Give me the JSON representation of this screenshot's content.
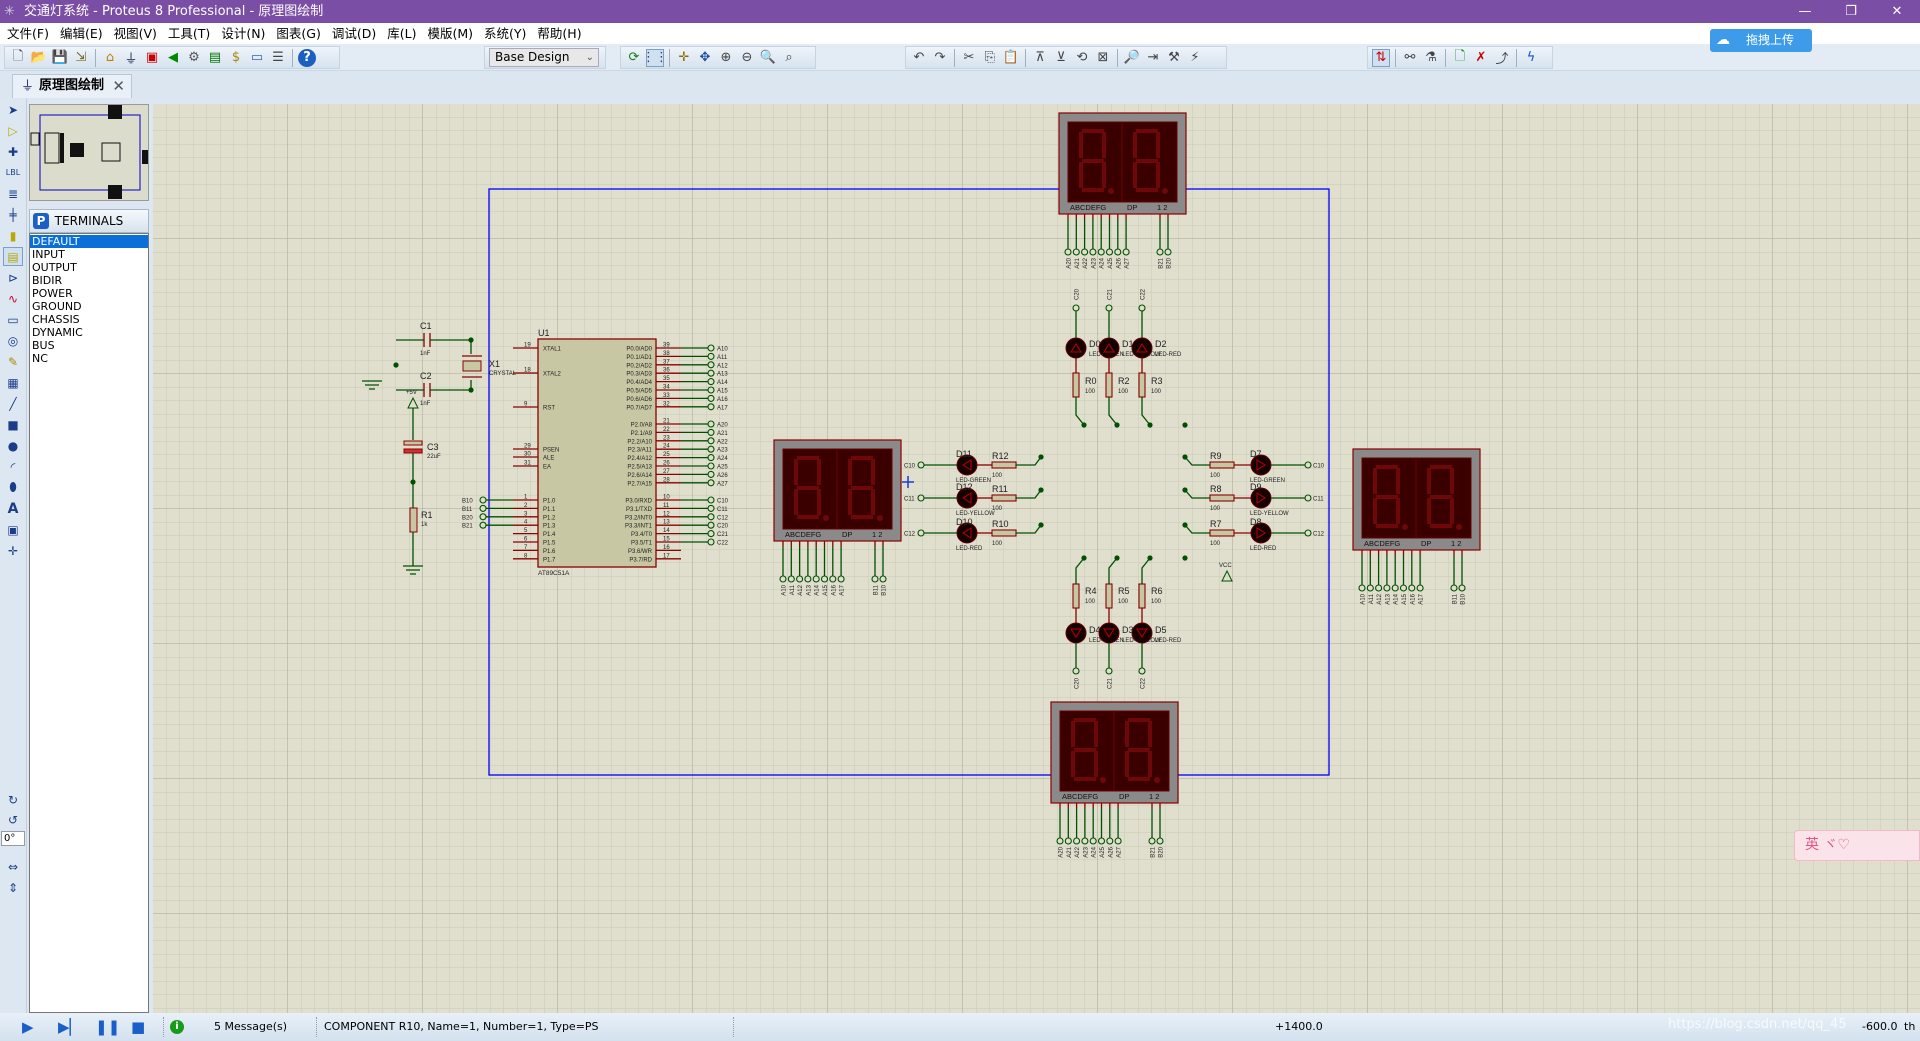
{
  "window": {
    "title": "交通灯系统 - Proteus 8 Professional - 原理图绘制",
    "min": "—",
    "restore": "❐",
    "close": "✕"
  },
  "menu": [
    "文件(F)",
    "编辑(E)",
    "视图(V)",
    "工具(T)",
    "设计(N)",
    "图表(G)",
    "调试(D)",
    "库(L)",
    "模版(M)",
    "系统(Y)",
    "帮助(H)"
  ],
  "toolbar": {
    "design_select": "Base Design",
    "help_icon": "?"
  },
  "upload_button": "拖拽上传",
  "tab": {
    "label": "原理图绘制",
    "close": "✕"
  },
  "panel": {
    "badge": "P",
    "header": "TERMINALS",
    "items": [
      "DEFAULT",
      "INPUT",
      "OUTPUT",
      "BIDIR",
      "POWER",
      "GROUND",
      "CHASSIS",
      "DYNAMIC",
      "BUS",
      "NC"
    ],
    "selected": "DEFAULT"
  },
  "rotation": "0°",
  "status": {
    "messages": "5 Message(s)",
    "info": "COMPONENT R10, Name=1, Number=1, Type=PS",
    "x": "+1400.0",
    "y": "-600.0",
    "unit": "th"
  },
  "ime_widget": "英 ヾ♡",
  "watermark": "https://blog.csdn.net/qq_45",
  "colors": {
    "titlebar": "#7a4ea4",
    "wire": "#005000",
    "pin": "#8b0000",
    "sheet_border": "#0000ff",
    "grid_bg": "#e0dfce",
    "selection": "#0a6fd8"
  },
  "schematic": {
    "u1": {
      "ref": "U1",
      "part": "AT89C51A",
      "left_pins": [
        {
          "num": "19",
          "name": "XTAL1"
        },
        {
          "num": "18",
          "name": "XTAL2"
        },
        {
          "num": "9",
          "name": "RST"
        },
        {
          "num": "29",
          "name": "PSEN"
        },
        {
          "num": "30",
          "name": "ALE"
        },
        {
          "num": "31",
          "name": "EA"
        },
        {
          "num": "1",
          "name": "P1.0",
          "net": "B10"
        },
        {
          "num": "2",
          "name": "P1.1",
          "net": "B11"
        },
        {
          "num": "3",
          "name": "P1.2",
          "net": "B20"
        },
        {
          "num": "4",
          "name": "P1.3",
          "net": "B21"
        },
        {
          "num": "5",
          "name": "P1.4"
        },
        {
          "num": "6",
          "name": "P1.5"
        },
        {
          "num": "7",
          "name": "P1.6"
        },
        {
          "num": "8",
          "name": "P1.7"
        }
      ],
      "right_pins": [
        {
          "num": "39",
          "name": "P0.0/AD0",
          "net": "A10"
        },
        {
          "num": "38",
          "name": "P0.1/AD1",
          "net": "A11"
        },
        {
          "num": "37",
          "name": "P0.2/AD2",
          "net": "A12"
        },
        {
          "num": "36",
          "name": "P0.3/AD3",
          "net": "A13"
        },
        {
          "num": "35",
          "name": "P0.4/AD4",
          "net": "A14"
        },
        {
          "num": "34",
          "name": "P0.5/AD5",
          "net": "A15"
        },
        {
          "num": "33",
          "name": "P0.6/AD6",
          "net": "A16"
        },
        {
          "num": "32",
          "name": "P0.7/AD7",
          "net": "A17"
        },
        {
          "num": "21",
          "name": "P2.0/A8",
          "net": "A20"
        },
        {
          "num": "22",
          "name": "P2.1/A9",
          "net": "A21"
        },
        {
          "num": "23",
          "name": "P2.2/A10",
          "net": "A22"
        },
        {
          "num": "24",
          "name": "P2.3/A11",
          "net": "A23"
        },
        {
          "num": "25",
          "name": "P2.4/A12",
          "net": "A24"
        },
        {
          "num": "26",
          "name": "P2.5/A13",
          "net": "A25"
        },
        {
          "num": "27",
          "name": "P2.6/A14",
          "net": "A26"
        },
        {
          "num": "28",
          "name": "P2.7/A15",
          "net": "A27"
        },
        {
          "num": "10",
          "name": "P3.0/RXD",
          "net": "C10"
        },
        {
          "num": "11",
          "name": "P3.1/TXD",
          "net": "C11"
        },
        {
          "num": "12",
          "name": "P3.2/INT0",
          "net": "C12"
        },
        {
          "num": "13",
          "name": "P3.3/INT1",
          "net": "C20"
        },
        {
          "num": "14",
          "name": "P3.4/T0",
          "net": "C21"
        },
        {
          "num": "15",
          "name": "P3.5/T1",
          "net": "C22"
        },
        {
          "num": "16",
          "name": "P3.6/WR"
        },
        {
          "num": "17",
          "name": "P3.7/RD"
        }
      ]
    },
    "c1": {
      "ref": "C1",
      "value": "1nF"
    },
    "c2": {
      "ref": "C2",
      "value": "1nF"
    },
    "c3": {
      "ref": "C3",
      "value": "22uF"
    },
    "x1": {
      "ref": "X1",
      "value": "CRYSTAL"
    },
    "r1": {
      "ref": "R1",
      "value": "1k"
    },
    "plus5v": "+5V",
    "vcc": "VCC",
    "display_pin_header": {
      "segments": "ABCDEFG",
      "dp": "DP",
      "digits": "1 2"
    },
    "displays": [
      {
        "pins": [
          "A20",
          "A21",
          "A22",
          "A23",
          "A24",
          "A25",
          "A26",
          "A27",
          "B21",
          "B20"
        ]
      },
      {
        "pins": [
          "A10",
          "A11",
          "A12",
          "A13",
          "A14",
          "A15",
          "A16",
          "A17",
          "B11",
          "B10"
        ]
      },
      {
        "pins": [
          "A10",
          "A11",
          "A12",
          "A13",
          "A14",
          "A15",
          "A16",
          "A17",
          "B11",
          "B10"
        ]
      },
      {
        "pins": [
          "A20",
          "A21",
          "A22",
          "A23",
          "A24",
          "A25",
          "A26",
          "A27",
          "B21",
          "B20"
        ]
      }
    ],
    "led_groups": {
      "top": {
        "leds": [
          {
            "ref": "D0",
            "type": "LED-GREEN"
          },
          {
            "ref": "D1",
            "type": "LED-YELLOW"
          },
          {
            "ref": "D2",
            "type": "LED-RED"
          }
        ],
        "res": [
          {
            "ref": "R0",
            "value": "100"
          },
          {
            "ref": "R2",
            "value": "100"
          },
          {
            "ref": "R3",
            "value": "100"
          }
        ],
        "nets": [
          "C20",
          "C21",
          "C22"
        ]
      },
      "bottom": {
        "leds": [
          {
            "ref": "D4",
            "type": "LED-GREEN"
          },
          {
            "ref": "D3",
            "type": "LED-YELLOW"
          },
          {
            "ref": "D5",
            "type": "LED-RED"
          }
        ],
        "res": [
          {
            "ref": "R4",
            "value": "100"
          },
          {
            "ref": "R5",
            "value": "100"
          },
          {
            "ref": "R6",
            "value": "100"
          }
        ],
        "nets": [
          "C20",
          "C21",
          "C22"
        ]
      },
      "left": {
        "leds": [
          {
            "ref": "D11",
            "type": "LED-GREEN"
          },
          {
            "ref": "D12",
            "type": "LED-YELLOW"
          },
          {
            "ref": "D10",
            "type": "LED-RED"
          }
        ],
        "res": [
          {
            "ref": "R12",
            "value": "100"
          },
          {
            "ref": "R11",
            "value": "100"
          },
          {
            "ref": "R10",
            "value": "100"
          }
        ],
        "nets": [
          "C10",
          "C11",
          "C12"
        ]
      },
      "right": {
        "leds": [
          {
            "ref": "D7",
            "type": "LED-GREEN"
          },
          {
            "ref": "D9",
            "type": "LED-YELLOW"
          },
          {
            "ref": "D8",
            "type": "LED-RED"
          }
        ],
        "res": [
          {
            "ref": "R9",
            "value": "100"
          },
          {
            "ref": "R8",
            "value": "100"
          },
          {
            "ref": "R7",
            "value": "100"
          }
        ],
        "nets": [
          "C10",
          "C11",
          "C12"
        ]
      }
    }
  }
}
